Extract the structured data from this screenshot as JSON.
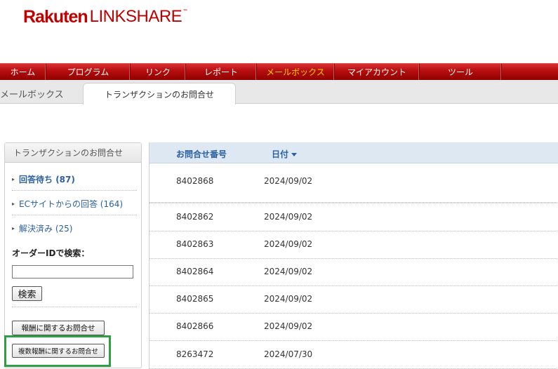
{
  "logo": {
    "rakuten": "Rakuten",
    "linkshare": "LINKSHARE",
    "tm": "™"
  },
  "nav": {
    "items": [
      {
        "label": "ホーム"
      },
      {
        "label": "プログラム"
      },
      {
        "label": "リンク"
      },
      {
        "label": "レポート"
      },
      {
        "label": "メールボックス",
        "active": true
      },
      {
        "label": "マイアカウント"
      },
      {
        "label": "ツール"
      }
    ],
    "bg_color": "#b50d0d",
    "active_color": "#ffd200"
  },
  "subnav": {
    "mailbox_tab": "メールボックス",
    "active_tab": "トランザクションのお問合せ"
  },
  "sidebar": {
    "title": "トランザクションのお問合せ",
    "items": [
      {
        "label": "回答待ち (87)",
        "bold": true
      },
      {
        "label": "ECサイトからの回答 (164)"
      },
      {
        "label": "解決済み (25)"
      }
    ],
    "search_label": "オーダーIDで検索：",
    "search_value": "",
    "search_button": "検索",
    "reward_button": "報酬に関するお問合せ",
    "multi_reward_button": "複数報酬に関するお問合せ",
    "link_color": "#2a5fa0",
    "highlight_color": "#2ea043"
  },
  "table": {
    "headers": {
      "inquiry_number": "お問合せ番号",
      "date": "日付"
    },
    "sort": {
      "column": "date",
      "direction": "desc"
    },
    "rows": [
      {
        "id": "8402868",
        "date": "2024/09/02"
      },
      {
        "id": "",
        "date": ""
      },
      {
        "id": "8402862",
        "date": "2024/09/02"
      },
      {
        "id": "8402863",
        "date": "2024/09/02"
      },
      {
        "id": "8402864",
        "date": "2024/09/02"
      },
      {
        "id": "8402865",
        "date": "2024/09/02"
      },
      {
        "id": "8402866",
        "date": "2024/09/02"
      },
      {
        "id": "8263472",
        "date": "2024/07/30"
      }
    ],
    "header_bg": "#dde8f3"
  }
}
